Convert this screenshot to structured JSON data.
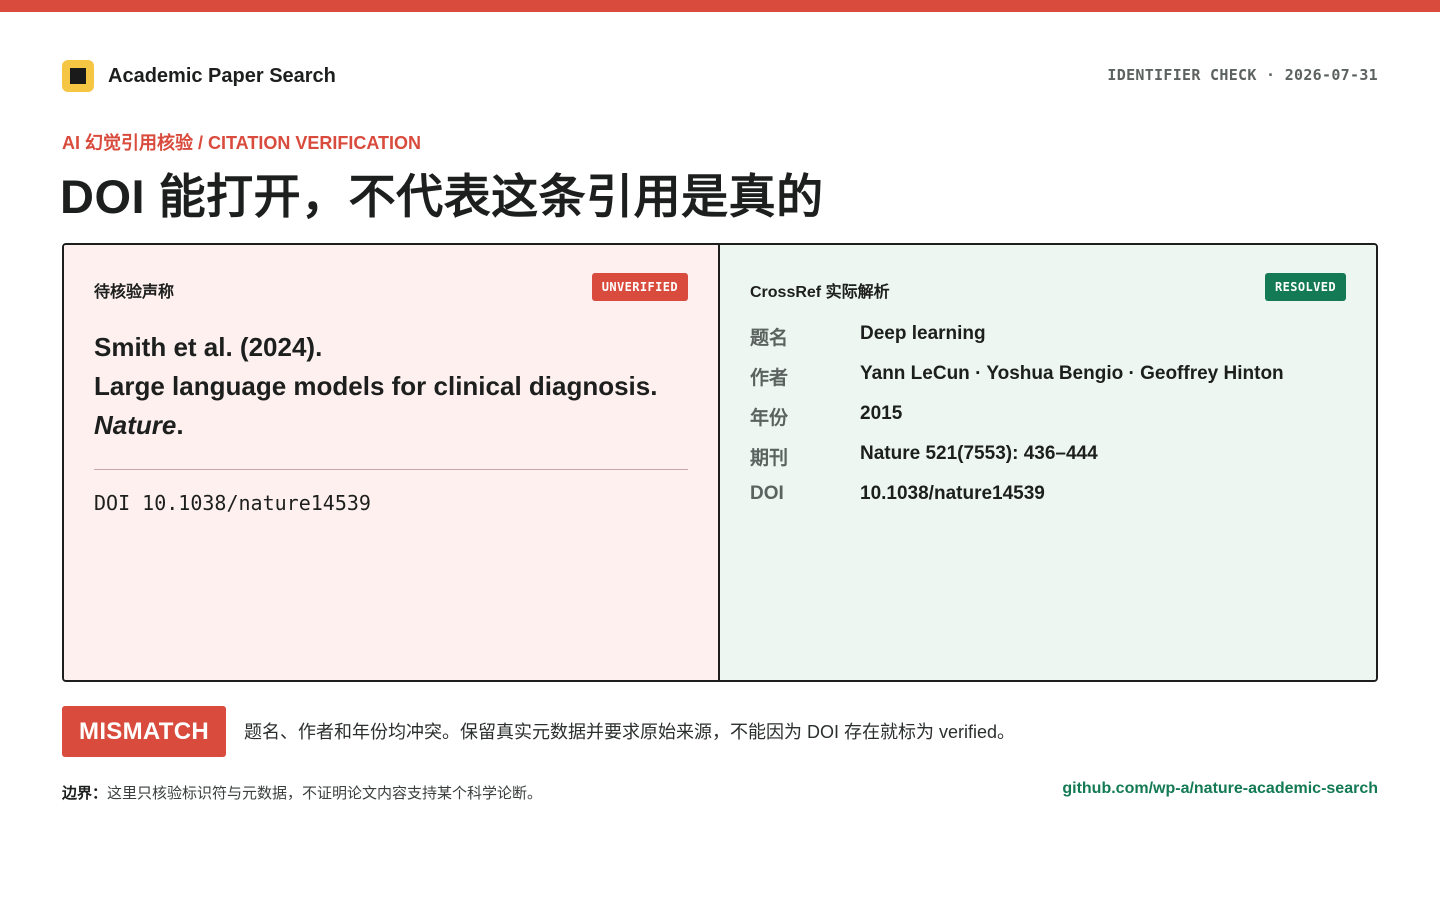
{
  "app": {
    "title": "Academic Paper Search",
    "meta": "IDENTIFIER CHECK · 2026-07-31",
    "logo_icon": "square-logo-icon"
  },
  "kicker": "AI 幻觉引用核验 / CITATION VERIFICATION",
  "headline": "DOI 能打开，不代表这条引用是真的",
  "claim_panel": {
    "label": "待核验声称",
    "badge": "UNVERIFIED",
    "citation_lines": [
      "Smith et al. (2024).",
      "Large language models for clinical diagnosis."
    ],
    "journal": "Nature",
    "journal_suffix": ".",
    "doi": "DOI 10.1038/nature14539"
  },
  "crossref_panel": {
    "label": "CrossRef 实际解析",
    "badge": "RESOLVED",
    "fields": [
      {
        "key": "题名",
        "value": "Deep learning"
      },
      {
        "key": "作者",
        "value": "Yann LeCun · Yoshua Bengio · Geoffrey Hinton"
      },
      {
        "key": "年份",
        "value": "2015"
      },
      {
        "key": "期刊",
        "value": "Nature 521(7553): 436–444"
      },
      {
        "key": "DOI",
        "value": "10.1038/nature14539"
      }
    ]
  },
  "verdict": {
    "badge": "MISMATCH",
    "message": "题名、作者和年份均冲突。保留真实元数据并要求原始来源，不能因为 DOI 存在就标为 verified。"
  },
  "footer": {
    "boundary_label": "边界：",
    "boundary_text": "这里只核验标识符与元数据，不证明论文内容支持某个科学论断。",
    "repo_link": "github.com/wp-a/nature-academic-search"
  },
  "colors": {
    "accent_red": "#d94b3d",
    "accent_green": "#137a55",
    "logo_yellow": "#f5c544",
    "claim_bg": "#fef0ee",
    "resolved_bg": "#edf6f0"
  }
}
